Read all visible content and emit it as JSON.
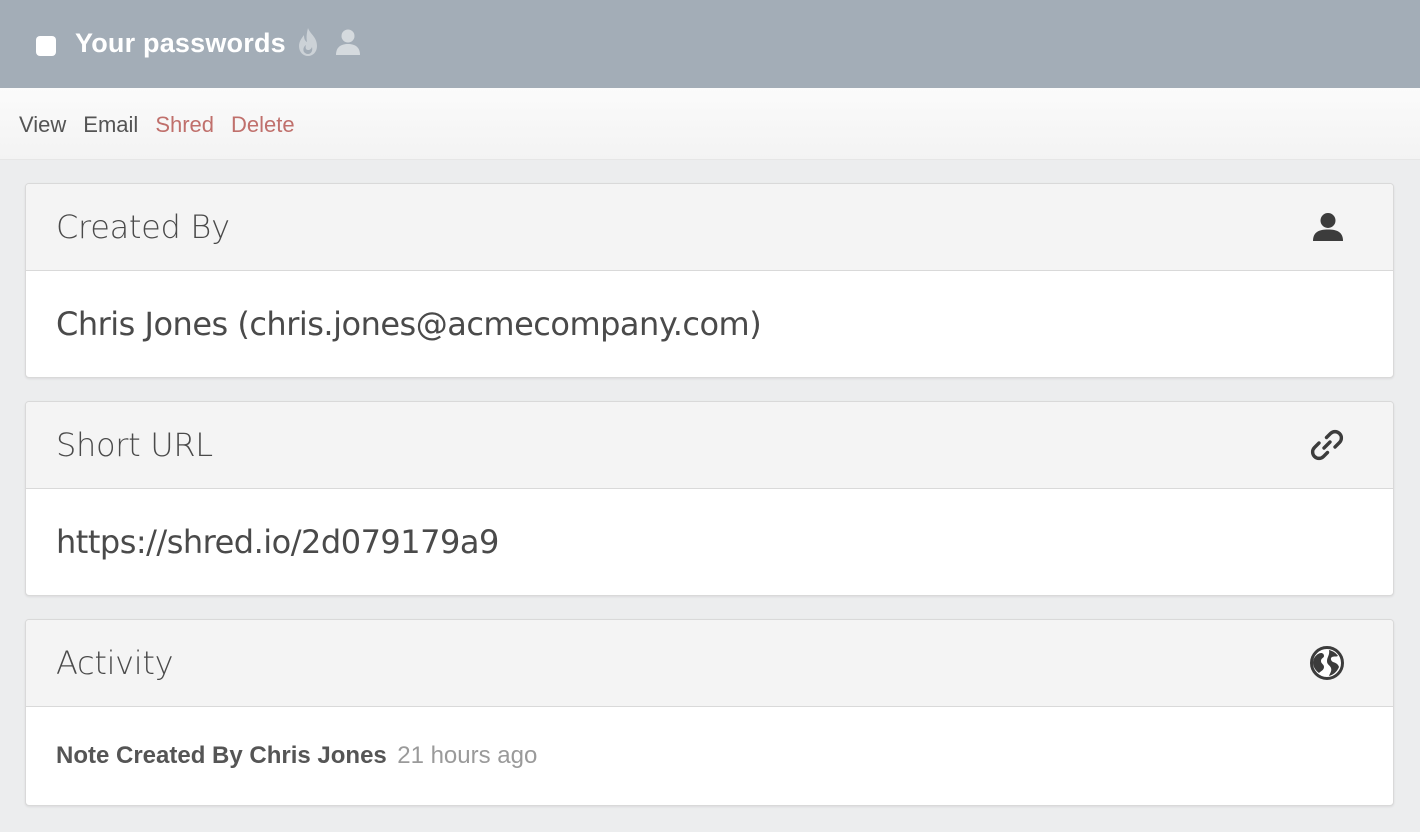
{
  "header": {
    "title": "Your passwords",
    "icons": [
      "checkbox",
      "flame-icon",
      "user-icon"
    ],
    "background_color": "#a3adb7"
  },
  "toolbar": {
    "actions": [
      {
        "label": "View",
        "style": "neutral"
      },
      {
        "label": "Email",
        "style": "neutral"
      },
      {
        "label": "Shred",
        "style": "danger"
      },
      {
        "label": "Delete",
        "style": "danger"
      }
    ],
    "danger_color": "#c0706c"
  },
  "panels": {
    "created_by": {
      "title": "Created By",
      "icon": "user-icon",
      "value": "Chris Jones (chris.jones@acmecompany.com)"
    },
    "short_url": {
      "title": "Short URL",
      "icon": "link-icon",
      "value": "https://shred.io/2d079179a9"
    },
    "activity": {
      "title": "Activity",
      "icon": "globe-icon",
      "entries": [
        {
          "who": "Note Created By Chris Jones",
          "when": "21 hours ago"
        }
      ]
    }
  }
}
